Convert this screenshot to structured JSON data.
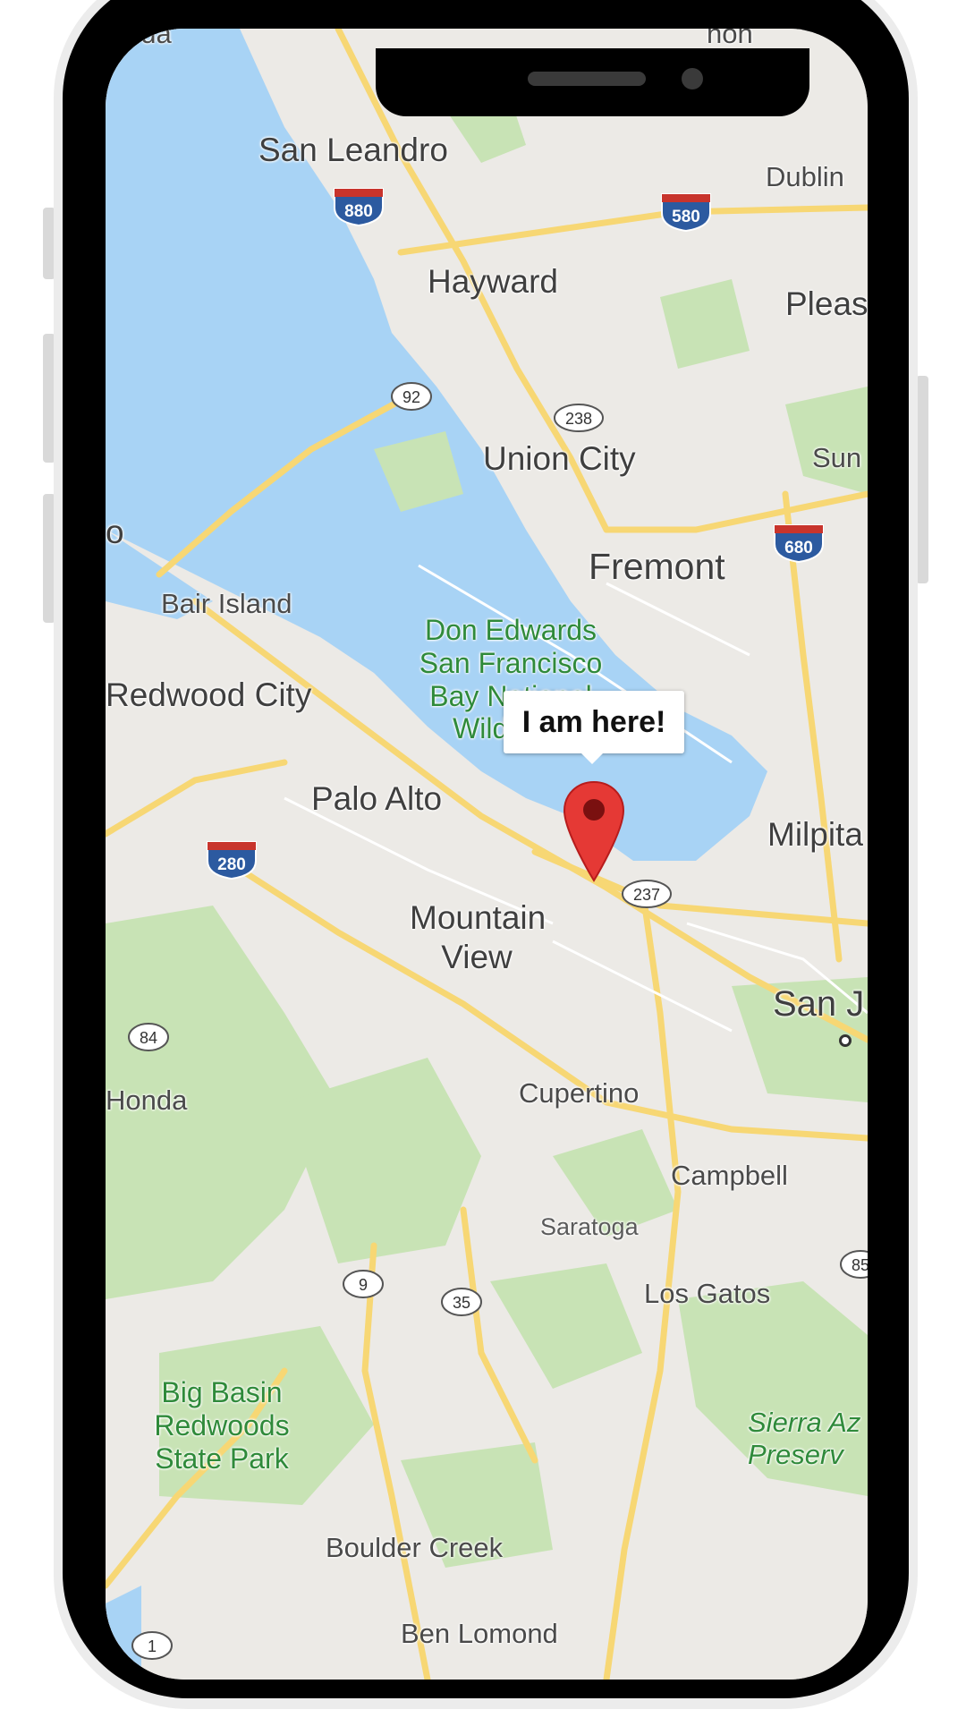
{
  "map": {
    "labels": {
      "eda": "eda",
      "non": "non",
      "san_leandro": "San Leandro",
      "dublin": "Dublin",
      "hayward": "Hayward",
      "pleas": "Pleas",
      "union_city": "Union City",
      "sun": "Sun",
      "o": "o",
      "fremont": "Fremont",
      "bair_island": "Bair Island",
      "redwood_city": "Redwood City",
      "palo_alto": "Palo Alto",
      "milpita": "Milpita",
      "mountain_view": "Mountain View",
      "san_j": "San J",
      "honda": "Honda",
      "cupertino": "Cupertino",
      "campbell": "Campbell",
      "saratoga": "Saratoga",
      "los_gatos": "Los Gatos",
      "big_basin": "Big Basin Redwoods State Park",
      "sierra": "Sierra Az Preserv",
      "boulder_creek": "Boulder Creek",
      "ben_lomond": "Ben Lomond",
      "don_edwards": "Don Edwards San Francisco Bay National Wildlife..."
    },
    "highways": {
      "i880": "880",
      "i580": "580",
      "i680": "680",
      "i280": "280",
      "r92": "92",
      "r238": "238",
      "r237": "237",
      "r84": "84",
      "r85": "85",
      "r9": "9",
      "r35": "35",
      "r1": "1"
    },
    "marker": {
      "callout_text": "I am here!",
      "color": "#e53935"
    },
    "directions_button": {
      "icon": "directions-icon",
      "color": "#1a73e8"
    }
  },
  "colors": {
    "water": "#a8d3f5",
    "land": "#eceae6",
    "park": "#c8e3b5",
    "road": "#f7d774"
  }
}
